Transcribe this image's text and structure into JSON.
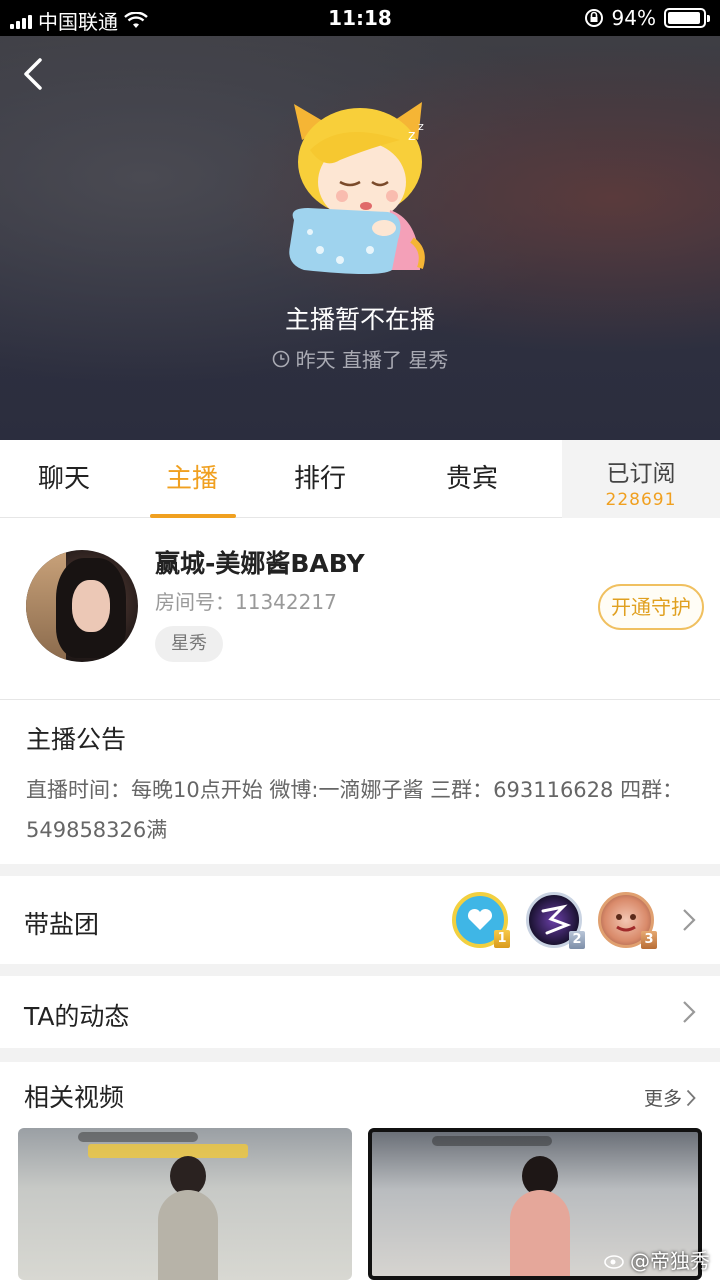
{
  "status_bar": {
    "carrier": "中国联通",
    "time": "11:18",
    "battery": "94%",
    "battery_level": 0.94
  },
  "hero": {
    "title": "主播暂不在播",
    "subtitle": "昨天 直播了 星秀",
    "icons": [
      "back-arrow-icon",
      "sleeping-mascot",
      "clock-icon"
    ]
  },
  "tabs": [
    {
      "label": "聊天"
    },
    {
      "label": "主播",
      "active": true
    },
    {
      "label": "排行"
    },
    {
      "label": "贵宾"
    }
  ],
  "subscribe": {
    "label": "已订阅",
    "count": "228691"
  },
  "profile": {
    "name": "赢城-美娜酱BABY",
    "room": "房间号：11342217",
    "tag": "星秀",
    "guard_button": "开通守护"
  },
  "announcement": {
    "title": "主播公告",
    "text": "直播时间：每晚10点开始 微博:一滴娜子酱 三群：693116628 四群：549858326满"
  },
  "fan_group": {
    "label": "带盐团",
    "ranks": [
      "1",
      "2",
      "3"
    ]
  },
  "dynamics": {
    "label": "TA的动态"
  },
  "videos": {
    "title": "相关视频",
    "more": "更多"
  },
  "watermark": "@帝独秀",
  "colors": {
    "accent": "#f0a020",
    "hero_dark": "#2f3140"
  }
}
